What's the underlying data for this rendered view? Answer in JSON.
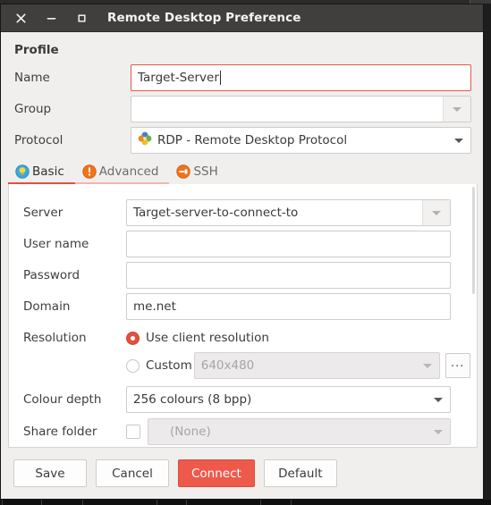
{
  "window": {
    "title": "Remote Desktop Preference",
    "controls": {
      "close": "close-icon",
      "minimize": "minimize-icon",
      "maximize": "maximize-icon"
    }
  },
  "profile": {
    "section_label": "Profile",
    "name": {
      "label": "Name",
      "value": "Target-Server",
      "focused": true
    },
    "group": {
      "label": "Group",
      "value": "",
      "placeholder": ""
    },
    "protocol": {
      "label": "Protocol",
      "value": "RDP - Remote Desktop Protocol",
      "icon": "rdp-protocol-icon"
    }
  },
  "tabs": [
    {
      "label": "Basic",
      "icon": "lightbulb-icon",
      "state": "active"
    },
    {
      "label": "Advanced",
      "icon": "warning-icon",
      "state": "half"
    },
    {
      "label": "SSH",
      "icon": "ssh-plug-icon",
      "state": "inactive"
    }
  ],
  "basic": {
    "server": {
      "label": "Server",
      "value": "Target-server-to-connect-to"
    },
    "username": {
      "label": "User name",
      "value": "",
      "placeholder": ""
    },
    "password": {
      "label": "Password",
      "value": "",
      "placeholder": ""
    },
    "domain": {
      "label": "Domain",
      "value": "me.net"
    },
    "resolution": {
      "label": "Resolution",
      "client_option": "Use client resolution",
      "client_selected": true,
      "custom_option": "Custom",
      "custom_selected": false,
      "custom_value": "640x480",
      "custom_enabled": false,
      "browse_label": "..."
    },
    "colour_depth": {
      "label": "Colour depth",
      "value": "256 colours (8 bpp)"
    },
    "share_folder": {
      "label": "Share folder",
      "checked": false,
      "value": "(None)",
      "enabled": false
    }
  },
  "buttons": {
    "save": "Save",
    "cancel": "Cancel",
    "connect": "Connect",
    "default": "Default"
  },
  "colors": {
    "accent": "#e2503f",
    "suggested_button": "#ed5a4b",
    "titlebar": "#413f3d",
    "window_bg": "#f0efee"
  }
}
